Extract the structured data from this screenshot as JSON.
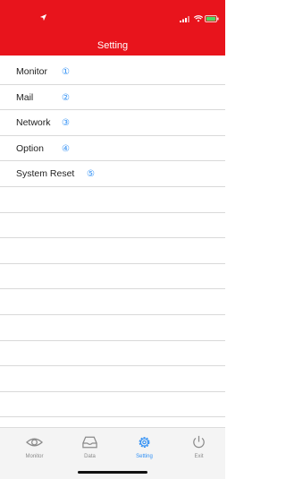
{
  "header": {
    "title": "Setting",
    "status_icons": [
      "location-arrow-icon",
      "cellular-signal-icon",
      "wifi-icon",
      "battery-icon"
    ]
  },
  "settings": {
    "items": [
      {
        "label": "Monitor",
        "number": "①"
      },
      {
        "label": "Mail",
        "number": "②"
      },
      {
        "label": "Network",
        "number": "③"
      },
      {
        "label": "Option",
        "number": "④"
      },
      {
        "label": "System Reset",
        "number": "⑤"
      }
    ]
  },
  "tabbar": {
    "tabs": [
      {
        "label": "Monitor",
        "icon": "eye-icon"
      },
      {
        "label": "Data",
        "icon": "inbox-tray-icon"
      },
      {
        "label": "Setting",
        "icon": "gear-icon",
        "active": true
      },
      {
        "label": "Exit",
        "icon": "power-icon"
      }
    ]
  },
  "colors": {
    "header": "#e8141c",
    "accent": "#2f8ff5",
    "battery": "#4cd964"
  }
}
